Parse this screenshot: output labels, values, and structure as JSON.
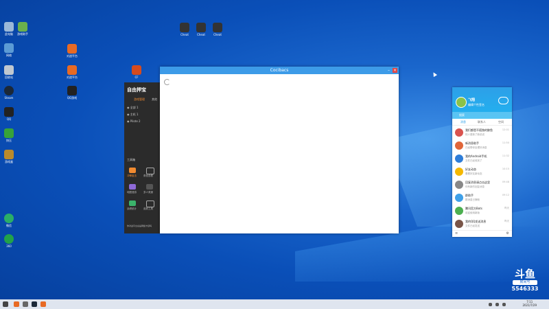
{
  "main_window": {
    "title": "Cocibacs"
  },
  "game_app": {
    "logo": "自由押宝",
    "tabs": [
      "游戏管理",
      "其他"
    ],
    "rows": [
      "全部 1",
      "主机 1",
      "Pilote 2"
    ],
    "section": "工具箱",
    "tools": [
      "冲锋狙击",
      "角色查看",
      "地图漫游",
      "多人竞速",
      "战绩统计",
      "皮肤工具"
    ],
    "footer": "你对战平台总是网络卡顿吗"
  },
  "qq": {
    "name": "飞翔",
    "sig": "编辑个性签名",
    "search_placeholder": "搜索",
    "tabs": [
      "消息",
      "联系人",
      "空间"
    ],
    "items": [
      {
        "name": "我们都是不孤独的鲸鱼",
        "msg": "别人更新了新说说",
        "time": "12:01",
        "color": "#d9534f"
      },
      {
        "name": "新消息助手",
        "msg": "已经帮你处理好消息",
        "time": "11:50",
        "color": "#e0663a"
      },
      {
        "name": "我的Android手机",
        "msg": "文件已经收到了",
        "time": "11:32",
        "color": "#2e7dd8"
      },
      {
        "name": "好友动态",
        "msg": "看看好友新动态",
        "time": "10:15",
        "color": "#f5b800"
      },
      {
        "name": "回复消息请点击这里",
        "msg": "你有新的回复消息",
        "time": "09:48",
        "color": "#888888"
      },
      {
        "name": "群助手",
        "msg": "群消息已静默",
        "time": "09:12",
        "color": "#3fa0e8"
      },
      {
        "name": "腾讯官方Bots",
        "msg": "欢迎使用新版",
        "time": "昨天",
        "color": "#4caf50"
      },
      {
        "name": "我的QQ发送消息",
        "msg": "文件已经发送",
        "time": "昨天",
        "color": "#795548"
      }
    ]
  },
  "desktop_icons": [
    {
      "label": "此电脑",
      "color": "#9ab8d8"
    },
    {
      "label": "游戏助手",
      "color": "#6ab04c"
    },
    {
      "label": "网络",
      "color": "#5b9bd5"
    },
    {
      "label": "回收站",
      "color": "#c0c8d0"
    },
    {
      "label": "Steam",
      "color": "#1b2838"
    },
    {
      "label": "QQ",
      "color": "#222222"
    },
    {
      "label": "快压",
      "color": "#37a33a"
    },
    {
      "label": "游戏盒",
      "color": "#b98a2c"
    },
    {
      "label": "微信",
      "color": "#2aae67"
    },
    {
      "label": "360",
      "color": "#21a24a"
    },
    {
      "label": "Cheat",
      "color": "#333333"
    },
    {
      "label": "Cheat",
      "color": "#333333"
    },
    {
      "label": "Cheat",
      "color": "#333333"
    },
    {
      "label": "对战平台",
      "color": "#e86a24"
    },
    {
      "label": "对战平台",
      "color": "#e86a24"
    },
    {
      "label": "QQ游戏",
      "color": "#222222"
    },
    {
      "label": "CF",
      "color": "#d64b1e"
    }
  ],
  "watermark": {
    "logo": "斗鱼",
    "sub": "房间号",
    "room": "5546333"
  },
  "taskbar": {
    "time": "7:11",
    "date": "2021/7/29"
  }
}
